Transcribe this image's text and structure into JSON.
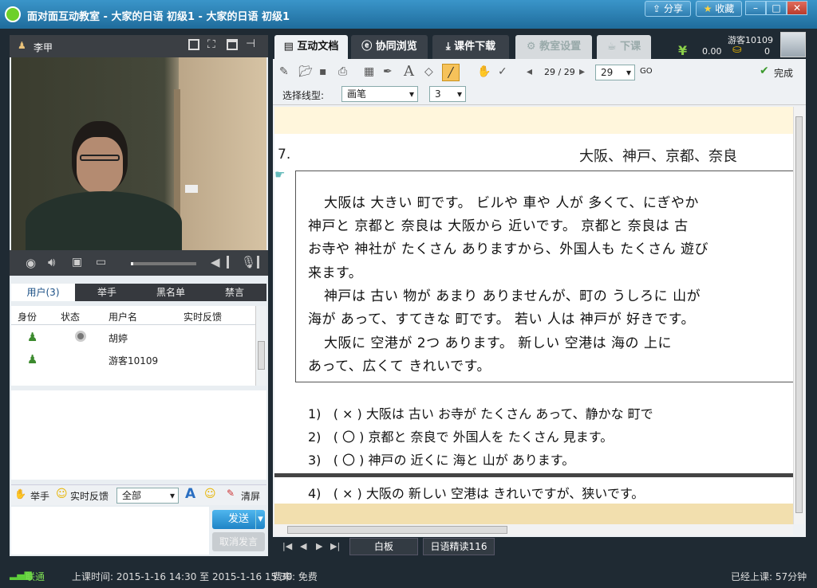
{
  "window": {
    "title": "面对面互动教室 - 大家的日语 初级1 - 大家的日语 初级1",
    "share_label": "分享",
    "favorite_label": "收藏"
  },
  "video": {
    "teacher_name": "李甲"
  },
  "user_panel": {
    "tabs": [
      "用户(3)",
      "举手",
      "黑名单",
      "禁言"
    ],
    "columns": [
      "身份",
      "状态",
      "用户名",
      "实时反馈"
    ],
    "users": [
      {
        "name": "胡婷",
        "has_camera": true
      },
      {
        "name": "游客10109",
        "has_camera": false
      }
    ]
  },
  "chat": {
    "hand_label": "举手",
    "feedback_label": "实时反馈",
    "target_value": "全部",
    "clear_label": "清屏",
    "send_label": "发送",
    "cancel_label": "取消发言"
  },
  "main_tabs": [
    {
      "label": "互动文档",
      "icon": "document-icon"
    },
    {
      "label": "协同浏览",
      "icon": "browser-icon"
    },
    {
      "label": "课件下载",
      "icon": "download-icon"
    },
    {
      "label": "教室设置",
      "icon": "gear-icon"
    },
    {
      "label": "下课",
      "icon": "cup-icon"
    }
  ],
  "account": {
    "username": "游客10109",
    "balance": "0.00",
    "coins": "0"
  },
  "toolbar": {
    "page_indicator": "29 / 29",
    "page_select": "29",
    "go_label": "GO",
    "done_label": "完成",
    "line_type_label": "选择线型:",
    "line_type_value": "画笔",
    "line_width_value": "3"
  },
  "document": {
    "section_number": "7.",
    "section_title": "大阪、神戸、京都、奈良",
    "passage": [
      "大阪は 大きい 町です。 ビルや 車や 人が 多くて、にぎやか",
      "神戸と 京都と 奈良は 大阪から 近いです。 京都と 奈良は 古",
      "お寺や 神社が たくさん ありますから、外国人も たくさん 遊び",
      "来ます。",
      "神戸は 古い 物が あまり ありませんが、町の うしろに 山が",
      "海が あって、すてきな 町です。 若い 人は 神戸が 好きです。",
      "大阪に 空港が 2つ あります。 新しい 空港は 海の 上に",
      "あって、広くて きれいです。"
    ],
    "questions": [
      {
        "num": "1)",
        "mark": "( × )",
        "text": "大阪は 古い お寺が たくさん あって、静かな 町で"
      },
      {
        "num": "2)",
        "mark": "( 〇 )",
        "text": "京都と 奈良で 外国人を たくさん 見ます。"
      },
      {
        "num": "3)",
        "mark": "( 〇 )",
        "text": "神戸の 近くに 海と 山が あります。"
      },
      {
        "num": "4)",
        "mark": "( × )",
        "text": "大阪の 新しい 空港は きれいですが、狭いです。"
      }
    ]
  },
  "page_tabs": [
    "白板",
    "日语精读116"
  ],
  "status": {
    "network": "联通",
    "class_time": "上课时间: 2015-1-16 14:30 至 2015-1-16 15:30",
    "fee": "费率: 免费",
    "elapsed": "已经上课: 57分钟"
  }
}
